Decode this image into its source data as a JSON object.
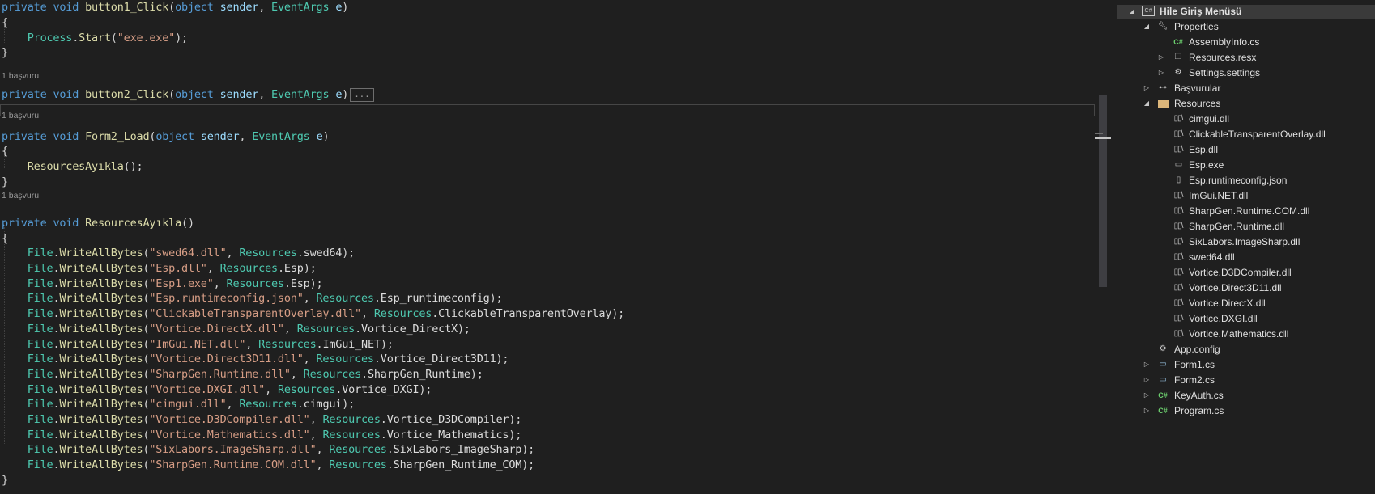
{
  "editor": {
    "refs_label": "1 başvuru",
    "lines": [
      {
        "tokens": [
          [
            "kw",
            "private"
          ],
          [
            "pn",
            " "
          ],
          [
            "kw",
            "void"
          ],
          [
            "pn",
            " "
          ],
          [
            "mt",
            "button1_Click"
          ],
          [
            "pn",
            "("
          ],
          [
            "kw",
            "object"
          ],
          [
            "pn",
            " "
          ],
          [
            "pm",
            "sender"
          ],
          [
            "pn",
            ", "
          ],
          [
            "ty",
            "EventArgs"
          ],
          [
            "pn",
            " "
          ],
          [
            "pm",
            "e"
          ],
          [
            "pn",
            ")"
          ]
        ]
      },
      {
        "tokens": [
          [
            "pn",
            "{"
          ]
        ]
      },
      {
        "tokens": [
          [
            "pn",
            "    "
          ],
          [
            "ty",
            "Process"
          ],
          [
            "pn",
            "."
          ],
          [
            "mt",
            "Start"
          ],
          [
            "pn",
            "("
          ],
          [
            "st",
            "\"exe.exe\""
          ],
          [
            "pn",
            ");"
          ]
        ]
      },
      {
        "tokens": [
          [
            "pn",
            "}"
          ]
        ]
      },
      {
        "tokens": [
          [
            "kw",
            "private"
          ],
          [
            "pn",
            " "
          ],
          [
            "kw",
            "void"
          ],
          [
            "pn",
            " "
          ],
          [
            "mt",
            "button2_Click"
          ],
          [
            "pn",
            "("
          ],
          [
            "kw",
            "object"
          ],
          [
            "pn",
            " "
          ],
          [
            "pm",
            "sender"
          ],
          [
            "pn",
            ", "
          ],
          [
            "ty",
            "EventArgs"
          ],
          [
            "pn",
            " "
          ],
          [
            "pm",
            "e"
          ],
          [
            "pn",
            ")"
          ]
        ],
        "collapsed": "..."
      },
      {
        "tokens": [
          [
            "kw",
            "private"
          ],
          [
            "pn",
            " "
          ],
          [
            "kw",
            "void"
          ],
          [
            "pn",
            " "
          ],
          [
            "mt",
            "Form2_Load"
          ],
          [
            "pn",
            "("
          ],
          [
            "kw",
            "object"
          ],
          [
            "pn",
            " "
          ],
          [
            "pm",
            "sender"
          ],
          [
            "pn",
            ", "
          ],
          [
            "ty",
            "EventArgs"
          ],
          [
            "pn",
            " "
          ],
          [
            "pm",
            "e"
          ],
          [
            "pn",
            ")"
          ]
        ]
      },
      {
        "tokens": [
          [
            "pn",
            "{"
          ]
        ]
      },
      {
        "tokens": [
          [
            "pn",
            "    "
          ],
          [
            "mt",
            "ResourcesAyıkla"
          ],
          [
            "pn",
            "();"
          ]
        ]
      },
      {
        "tokens": [
          [
            "pn",
            "}"
          ]
        ]
      },
      {
        "tokens": [
          [
            "kw",
            "private"
          ],
          [
            "pn",
            " "
          ],
          [
            "kw",
            "void"
          ],
          [
            "pn",
            " "
          ],
          [
            "mt",
            "ResourcesAyıkla"
          ],
          [
            "pn",
            "()"
          ]
        ]
      },
      {
        "tokens": [
          [
            "pn",
            "{"
          ]
        ]
      },
      {
        "tokens": [
          [
            "pn",
            "    "
          ],
          [
            "ty",
            "File"
          ],
          [
            "pn",
            "."
          ],
          [
            "mt",
            "WriteAllBytes"
          ],
          [
            "pn",
            "("
          ],
          [
            "st",
            "\"swed64.dll\""
          ],
          [
            "pn",
            ", "
          ],
          [
            "ty",
            "Resources"
          ],
          [
            "pn",
            "."
          ],
          [
            "id",
            "swed64"
          ],
          [
            "pn",
            ");"
          ]
        ]
      },
      {
        "tokens": [
          [
            "pn",
            "    "
          ],
          [
            "ty",
            "File"
          ],
          [
            "pn",
            "."
          ],
          [
            "mt",
            "WriteAllBytes"
          ],
          [
            "pn",
            "("
          ],
          [
            "st",
            "\"Esp.dll\""
          ],
          [
            "pn",
            ", "
          ],
          [
            "ty",
            "Resources"
          ],
          [
            "pn",
            "."
          ],
          [
            "id",
            "Esp"
          ],
          [
            "pn",
            ");"
          ]
        ]
      },
      {
        "tokens": [
          [
            "pn",
            "    "
          ],
          [
            "ty",
            "File"
          ],
          [
            "pn",
            "."
          ],
          [
            "mt",
            "WriteAllBytes"
          ],
          [
            "pn",
            "("
          ],
          [
            "st",
            "\"Esp1.exe\""
          ],
          [
            "pn",
            ", "
          ],
          [
            "ty",
            "Resources"
          ],
          [
            "pn",
            "."
          ],
          [
            "id",
            "Esp"
          ],
          [
            "pn",
            ");"
          ]
        ]
      },
      {
        "tokens": [
          [
            "pn",
            "    "
          ],
          [
            "ty",
            "File"
          ],
          [
            "pn",
            "."
          ],
          [
            "mt",
            "WriteAllBytes"
          ],
          [
            "pn",
            "("
          ],
          [
            "st",
            "\"Esp.runtimeconfig.json\""
          ],
          [
            "pn",
            ", "
          ],
          [
            "ty",
            "Resources"
          ],
          [
            "pn",
            "."
          ],
          [
            "id",
            "Esp_runtimeconfig"
          ],
          [
            "pn",
            ");"
          ]
        ]
      },
      {
        "tokens": [
          [
            "pn",
            "    "
          ],
          [
            "ty",
            "File"
          ],
          [
            "pn",
            "."
          ],
          [
            "mt",
            "WriteAllBytes"
          ],
          [
            "pn",
            "("
          ],
          [
            "st",
            "\"ClickableTransparentOverlay.dll\""
          ],
          [
            "pn",
            ", "
          ],
          [
            "ty",
            "Resources"
          ],
          [
            "pn",
            "."
          ],
          [
            "id",
            "ClickableTransparentOverlay"
          ],
          [
            "pn",
            ");"
          ]
        ]
      },
      {
        "tokens": [
          [
            "pn",
            "    "
          ],
          [
            "ty",
            "File"
          ],
          [
            "pn",
            "."
          ],
          [
            "mt",
            "WriteAllBytes"
          ],
          [
            "pn",
            "("
          ],
          [
            "st",
            "\"Vortice.DirectX.dll\""
          ],
          [
            "pn",
            ", "
          ],
          [
            "ty",
            "Resources"
          ],
          [
            "pn",
            "."
          ],
          [
            "id",
            "Vortice_DirectX"
          ],
          [
            "pn",
            ");"
          ]
        ]
      },
      {
        "tokens": [
          [
            "pn",
            "    "
          ],
          [
            "ty",
            "File"
          ],
          [
            "pn",
            "."
          ],
          [
            "mt",
            "WriteAllBytes"
          ],
          [
            "pn",
            "("
          ],
          [
            "st",
            "\"ImGui.NET.dll\""
          ],
          [
            "pn",
            ", "
          ],
          [
            "ty",
            "Resources"
          ],
          [
            "pn",
            "."
          ],
          [
            "id",
            "ImGui_NET"
          ],
          [
            "pn",
            ");"
          ]
        ]
      },
      {
        "tokens": [
          [
            "pn",
            "    "
          ],
          [
            "ty",
            "File"
          ],
          [
            "pn",
            "."
          ],
          [
            "mt",
            "WriteAllBytes"
          ],
          [
            "pn",
            "("
          ],
          [
            "st",
            "\"Vortice.Direct3D11.dll\""
          ],
          [
            "pn",
            ", "
          ],
          [
            "ty",
            "Resources"
          ],
          [
            "pn",
            "."
          ],
          [
            "id",
            "Vortice_Direct3D11"
          ],
          [
            "pn",
            ");"
          ]
        ]
      },
      {
        "tokens": [
          [
            "pn",
            "    "
          ],
          [
            "ty",
            "File"
          ],
          [
            "pn",
            "."
          ],
          [
            "mt",
            "WriteAllBytes"
          ],
          [
            "pn",
            "("
          ],
          [
            "st",
            "\"SharpGen.Runtime.dll\""
          ],
          [
            "pn",
            ", "
          ],
          [
            "ty",
            "Resources"
          ],
          [
            "pn",
            "."
          ],
          [
            "id",
            "SharpGen_Runtime"
          ],
          [
            "pn",
            ");"
          ]
        ]
      },
      {
        "tokens": [
          [
            "pn",
            "    "
          ],
          [
            "ty",
            "File"
          ],
          [
            "pn",
            "."
          ],
          [
            "mt",
            "WriteAllBytes"
          ],
          [
            "pn",
            "("
          ],
          [
            "st",
            "\"Vortice.DXGI.dll\""
          ],
          [
            "pn",
            ", "
          ],
          [
            "ty",
            "Resources"
          ],
          [
            "pn",
            "."
          ],
          [
            "id",
            "Vortice_DXGI"
          ],
          [
            "pn",
            ");"
          ]
        ]
      },
      {
        "tokens": [
          [
            "pn",
            "    "
          ],
          [
            "ty",
            "File"
          ],
          [
            "pn",
            "."
          ],
          [
            "mt",
            "WriteAllBytes"
          ],
          [
            "pn",
            "("
          ],
          [
            "st",
            "\"cimgui.dll\""
          ],
          [
            "pn",
            ", "
          ],
          [
            "ty",
            "Resources"
          ],
          [
            "pn",
            "."
          ],
          [
            "id",
            "cimgui"
          ],
          [
            "pn",
            ");"
          ]
        ]
      },
      {
        "tokens": [
          [
            "pn",
            "    "
          ],
          [
            "ty",
            "File"
          ],
          [
            "pn",
            "."
          ],
          [
            "mt",
            "WriteAllBytes"
          ],
          [
            "pn",
            "("
          ],
          [
            "st",
            "\"Vortice.D3DCompiler.dll\""
          ],
          [
            "pn",
            ", "
          ],
          [
            "ty",
            "Resources"
          ],
          [
            "pn",
            "."
          ],
          [
            "id",
            "Vortice_D3DCompiler"
          ],
          [
            "pn",
            ");"
          ]
        ]
      },
      {
        "tokens": [
          [
            "pn",
            "    "
          ],
          [
            "ty",
            "File"
          ],
          [
            "pn",
            "."
          ],
          [
            "mt",
            "WriteAllBytes"
          ],
          [
            "pn",
            "("
          ],
          [
            "st",
            "\"Vortice.Mathematics.dll\""
          ],
          [
            "pn",
            ", "
          ],
          [
            "ty",
            "Resources"
          ],
          [
            "pn",
            "."
          ],
          [
            "id",
            "Vortice_Mathematics"
          ],
          [
            "pn",
            ");"
          ]
        ]
      },
      {
        "tokens": [
          [
            "pn",
            "    "
          ],
          [
            "ty",
            "File"
          ],
          [
            "pn",
            "."
          ],
          [
            "mt",
            "WriteAllBytes"
          ],
          [
            "pn",
            "("
          ],
          [
            "st",
            "\"SixLabors.ImageSharp.dll\""
          ],
          [
            "pn",
            ", "
          ],
          [
            "ty",
            "Resources"
          ],
          [
            "pn",
            "."
          ],
          [
            "id",
            "SixLabors_ImageSharp"
          ],
          [
            "pn",
            ");"
          ]
        ]
      },
      {
        "tokens": [
          [
            "pn",
            "    "
          ],
          [
            "ty",
            "File"
          ],
          [
            "pn",
            "."
          ],
          [
            "mt",
            "WriteAllBytes"
          ],
          [
            "pn",
            "("
          ],
          [
            "st",
            "\"SharpGen.Runtime.COM.dll\""
          ],
          [
            "pn",
            ", "
          ],
          [
            "ty",
            "Resources"
          ],
          [
            "pn",
            "."
          ],
          [
            "id",
            "SharpGen_Runtime_COM"
          ],
          [
            "pn",
            ");"
          ]
        ]
      },
      {
        "tokens": [
          [
            "pn",
            "}"
          ]
        ]
      }
    ]
  },
  "solution_explorer": {
    "project": "Hile Giriş Menüsü",
    "properties": "Properties",
    "assemblyinfo": "AssemblyInfo.cs",
    "resources_resx": "Resources.resx",
    "settings": "Settings.settings",
    "references": "Başvurular",
    "resources_folder": "Resources",
    "resource_files": [
      {
        "name": "cimgui.dll",
        "icon": "dll-icon"
      },
      {
        "name": "ClickableTransparentOverlay.dll",
        "icon": "dll-icon"
      },
      {
        "name": "Esp.dll",
        "icon": "dll-icon"
      },
      {
        "name": "Esp.exe",
        "icon": "exe-icon"
      },
      {
        "name": "Esp.runtimeconfig.json",
        "icon": "json-icon"
      },
      {
        "name": "ImGui.NET.dll",
        "icon": "dll-icon"
      },
      {
        "name": "SharpGen.Runtime.COM.dll",
        "icon": "dll-icon"
      },
      {
        "name": "SharpGen.Runtime.dll",
        "icon": "dll-icon"
      },
      {
        "name": "SixLabors.ImageSharp.dll",
        "icon": "dll-icon"
      },
      {
        "name": "swed64.dll",
        "icon": "dll-icon"
      },
      {
        "name": "Vortice.D3DCompiler.dll",
        "icon": "dll-icon"
      },
      {
        "name": "Vortice.Direct3D11.dll",
        "icon": "dll-icon"
      },
      {
        "name": "Vortice.DirectX.dll",
        "icon": "dll-icon"
      },
      {
        "name": "Vortice.DXGI.dll",
        "icon": "dll-icon"
      },
      {
        "name": "Vortice.Mathematics.dll",
        "icon": "dll-icon"
      }
    ],
    "app_config": "App.config",
    "form1": "Form1.cs",
    "form2": "Form2.cs",
    "keyauth": "KeyAuth.cs",
    "program": "Program.cs",
    "cs_badge": "C#"
  }
}
